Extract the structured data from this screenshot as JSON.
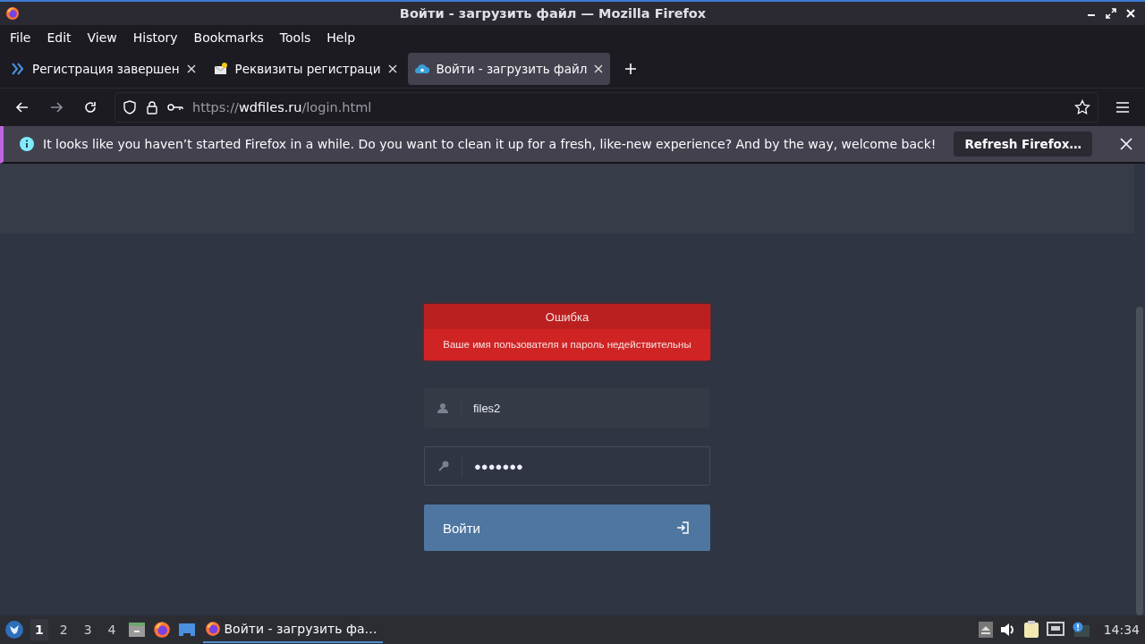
{
  "window": {
    "title": "Войти - загрузить файл — Mozilla Firefox"
  },
  "menu": [
    "File",
    "Edit",
    "View",
    "History",
    "Bookmarks",
    "Tools",
    "Help"
  ],
  "tabs": [
    {
      "label": "Регистрация завершен",
      "selected": false
    },
    {
      "label": "Реквизиты регистраци",
      "selected": false
    },
    {
      "label": "Войти - загрузить файл",
      "selected": true
    }
  ],
  "address": {
    "scheme": "https://",
    "host": "wdfiles.ru",
    "path": "/login.html"
  },
  "notification": {
    "message": "It looks like you haven’t started Firefox in a while. Do you want to clean it up for a fresh, like-new experience? And by the way, welcome back!",
    "button": "Refresh Firefox…"
  },
  "login": {
    "error_title": "Ошибка",
    "error_message": "Ваше имя пользователя и пароль недействительны",
    "username": "files2",
    "password": "●●●●●●●",
    "submit": "Войти"
  },
  "taskbar": {
    "workspaces": [
      {
        "label": "1",
        "selected": true
      },
      {
        "label": "2",
        "selected": false
      },
      {
        "label": "3",
        "selected": false
      },
      {
        "label": "4",
        "selected": false
      }
    ],
    "task": "Войти - загрузить фа…",
    "clock": "14:34"
  }
}
